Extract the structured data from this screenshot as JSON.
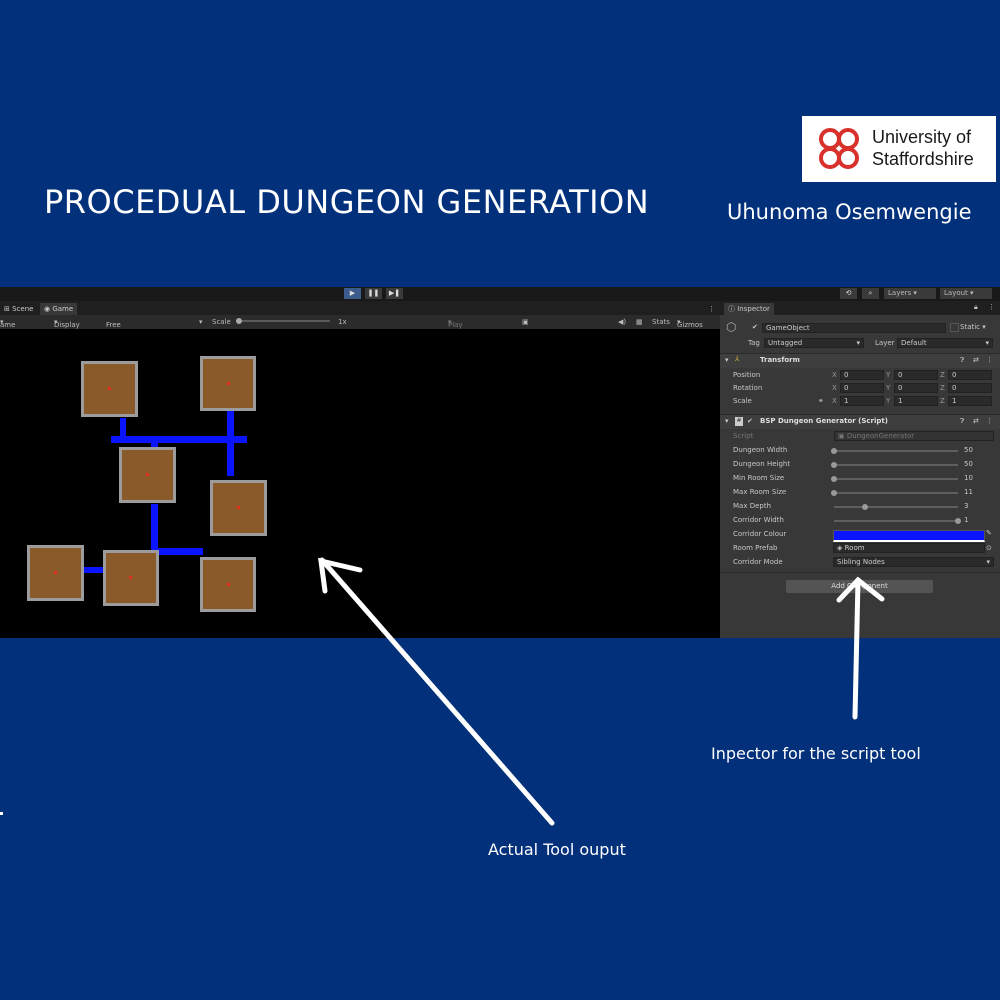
{
  "slide": {
    "title": "PROCEDUAL DUNGEON GENERATION",
    "author": "Uhunoma Osemwengie",
    "logo_line1": "University of",
    "logo_line2": "Staffordshire",
    "caption_output": "Actual Tool ouput",
    "caption_inspector": "Inpector for the script tool"
  },
  "toolbar": {
    "play": "▶",
    "pause": "❚❚",
    "step": "▶❚",
    "layers": "Layers",
    "layout": "Layout"
  },
  "game": {
    "tabs": [
      "Scene",
      "Game"
    ],
    "display_mode": "ame",
    "display": "Display 1",
    "aspect": "Free Aspect",
    "scale_label": "Scale",
    "scale_value": "1x",
    "play_focused": "Play Focused",
    "stats": "Stats",
    "gizmos": "Gizmos"
  },
  "inspector": {
    "tab": "Inspector",
    "object_name": "GameObject",
    "static_label": "Static",
    "tag_label": "Tag",
    "tag_value": "Untagged",
    "layer_label": "Layer",
    "layer_value": "Default",
    "transform": {
      "title": "Transform",
      "rows": [
        {
          "label": "Position",
          "x": "0",
          "y": "0",
          "z": "0"
        },
        {
          "label": "Rotation",
          "x": "0",
          "y": "0",
          "z": "0"
        },
        {
          "label": "Scale",
          "x": "1",
          "y": "1",
          "z": "1"
        }
      ]
    },
    "script": {
      "title": "BSP Dungeon Generator (Script)",
      "script_label": "Script",
      "script_value": "DungeonGenerator",
      "sliders": [
        {
          "label": "Dungeon Width",
          "value": "50",
          "fraction": 0.0
        },
        {
          "label": "Dungeon Height",
          "value": "50",
          "fraction": 0.0
        },
        {
          "label": "Min Room Size",
          "value": "10",
          "fraction": 0.0
        },
        {
          "label": "Max Room Size",
          "value": "11",
          "fraction": 0.0
        },
        {
          "label": "Max Depth",
          "value": "3",
          "fraction": 0.25
        },
        {
          "label": "Corridor Width",
          "value": "1",
          "fraction": 1.0
        }
      ],
      "corridor_colour_label": "Corridor Colour",
      "corridor_colour": "#0a14ff",
      "room_prefab_label": "Room Prefab",
      "room_prefab_value": "Room",
      "corridor_mode_label": "Corridor Mode",
      "corridor_mode_value": "Sibling Nodes"
    },
    "add_component": "Add Component"
  },
  "colors": {
    "background": "#02307a",
    "room_fill": "#8a5a2b",
    "room_border": "#9c9c9c",
    "corridor": "#0a14ff",
    "room_marker": "#e0301e"
  }
}
